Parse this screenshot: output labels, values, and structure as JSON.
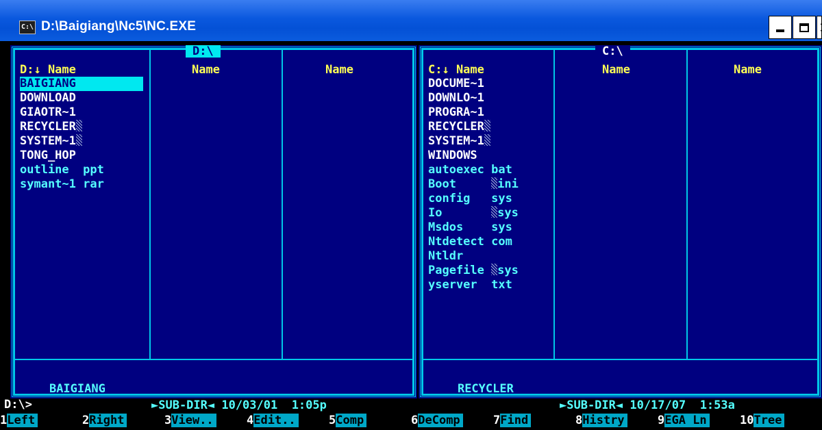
{
  "window": {
    "title": "D:\\Baigiang\\Nc5\\NC.EXE",
    "icon_text": "C:\\",
    "min_glyph": "",
    "max_glyph": "",
    "close_glyph": "×"
  },
  "colors": {
    "panel_bg": "#000080",
    "frame": "#00c8e8",
    "header": "#ffff55",
    "file": "#55ffff",
    "selection": "#00e8f0"
  },
  "left_panel": {
    "title": "D:\\",
    "col_headers": [
      "D:↓ Name",
      "Name",
      "Name"
    ],
    "files": [
      {
        "name": "BAIGIANG",
        "dir": true,
        "selected": true
      },
      {
        "name": "DOWNLOAD",
        "dir": true
      },
      {
        "name": "GIAOTR~1",
        "dir": true
      },
      {
        "name": "RECYCLER",
        "dir": true,
        "shade": true
      },
      {
        "name": "SYSTEM~1",
        "dir": true,
        "shade": true
      },
      {
        "name": "TONG_HOP",
        "dir": true
      },
      {
        "name": "outline  ppt"
      },
      {
        "name": "symant~1 rar"
      }
    ],
    "status_name": "BAIGIANG",
    "status_info": "►SUB-DIR◄ 10/03/01  1:05p"
  },
  "right_panel": {
    "title": "C:\\",
    "col_headers": [
      "C:↓ Name",
      "Name",
      "Name"
    ],
    "files": [
      {
        "name": "DOCUME~1",
        "dir": true
      },
      {
        "name": "DOWNLO~1",
        "dir": true
      },
      {
        "name": "PROGRA~1",
        "dir": true
      },
      {
        "name": "RECYCLER",
        "dir": true,
        "shade": true
      },
      {
        "name": "SYSTEM~1",
        "dir": true,
        "shade": true
      },
      {
        "name": "WINDOWS",
        "dir": true
      },
      {
        "name": "autoexec bat"
      },
      {
        "name": "Boot     ",
        "ext": "ini",
        "shade": true
      },
      {
        "name": "config   sys"
      },
      {
        "name": "Io       ",
        "ext": "sys",
        "shade": true
      },
      {
        "name": "Msdos    sys"
      },
      {
        "name": "Ntdetect com"
      },
      {
        "name": "Ntldr"
      },
      {
        "name": "Pagefile ",
        "ext": "sys",
        "shade": true
      },
      {
        "name": "yserver  txt"
      }
    ],
    "status_name": "RECYCLER",
    "status_info": "►SUB-DIR◄ 10/17/07  1:53a"
  },
  "prompt": "D:\\>",
  "function_keys": [
    {
      "num": "1",
      "label": "Left"
    },
    {
      "num": "2",
      "label": "Right"
    },
    {
      "num": "3",
      "label": "View.."
    },
    {
      "num": "4",
      "label": "Edit.."
    },
    {
      "num": "5",
      "label": "Comp"
    },
    {
      "num": "6",
      "label": "DeComp"
    },
    {
      "num": "7",
      "label": "Find"
    },
    {
      "num": "8",
      "label": "Histry"
    },
    {
      "num": "9",
      "label": "EGA Ln"
    },
    {
      "num": "10",
      "label": "Tree"
    }
  ]
}
